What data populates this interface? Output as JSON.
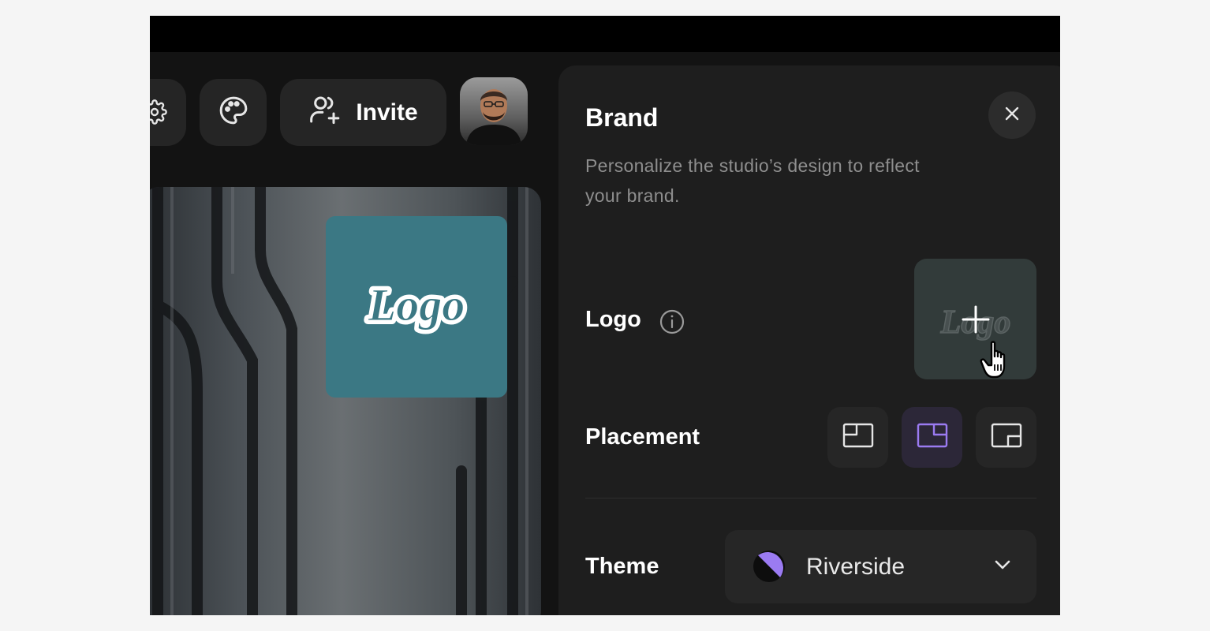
{
  "toolbar": {
    "invite_label": "Invite",
    "icons": [
      "gear-icon",
      "palette-icon",
      "user-plus-icon"
    ]
  },
  "preview": {
    "logo_text": "Logo",
    "logo_tile_color": "#3b7884"
  },
  "panel": {
    "title": "Brand",
    "description": "Personalize the studio’s design to reflect your brand.",
    "logo_label": "Logo",
    "placement_label": "Placement",
    "placement_options": [
      "top-left",
      "top-right",
      "bottom-right"
    ],
    "placement_selected": "top-right",
    "theme_label": "Theme",
    "theme_value": "Riverside",
    "accent_color": "#9b7bf2"
  }
}
